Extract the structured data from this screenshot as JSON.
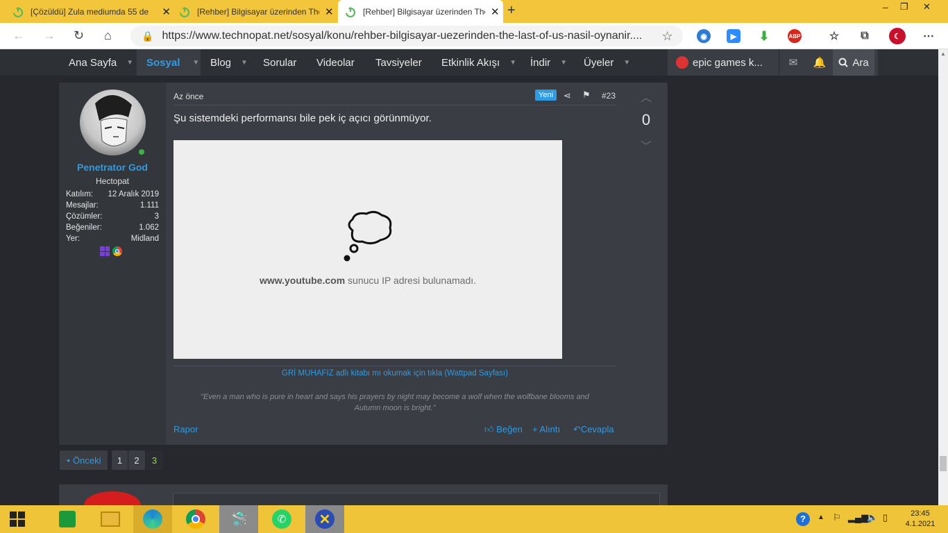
{
  "browser": {
    "tabs": [
      {
        "title": "[Çözüldü] Zula mediumda 55 de"
      },
      {
        "title": "[Rehber] Bilgisayar üzerinden The"
      },
      {
        "title": "[Rehber] Bilgisayar üzerinden The"
      }
    ],
    "new_tab": "+",
    "url": "https://www.technopat.net/sosyal/konu/rehber-bilgisayar-uezerinden-the-last-of-us-nasil-oynanir....",
    "extensions": {
      "abp": "ABP"
    }
  },
  "nav": {
    "items": [
      "Ana Sayfa",
      "Sosyal",
      "Blog",
      "Sorular",
      "Videolar",
      "Tavsiyeler",
      "Etkinlik Akışı",
      "İndir",
      "Üyeler"
    ],
    "search_query": "epic games k...",
    "search_label": "Ara"
  },
  "post": {
    "user": {
      "name": "Penetrator God",
      "title": "Hectopat",
      "stats": [
        {
          "label": "Katılım:",
          "value": "12 Aralık 2019"
        },
        {
          "label": "Mesajlar:",
          "value": "1.111"
        },
        {
          "label": "Çözümler:",
          "value": "3"
        },
        {
          "label": "Beğeniler:",
          "value": "1.062"
        },
        {
          "label": "Yer:",
          "value": "Midland"
        }
      ]
    },
    "time": "Az önce",
    "badge": "Yeni",
    "number": "#23",
    "message": "Şu sistemdeki performansı bile pek iç açıcı görünmüyor.",
    "embed_error_host": "www.youtube.com",
    "embed_error_text": " sunucu IP adresi bulunamadı.",
    "signature_link": "GRİ MUHAFIZ adlı kitabı mı okumak için tıkla (Wattpad Sayfası)",
    "signature_quote": "\"Even a man who is pure in heart and says his prayers by night may become a wolf when the wolfbane blooms and Autumn moon is bright.\"",
    "report": "Rapor",
    "like": "Beğen",
    "quote": "+ Alıntı",
    "reply": "Cevapla",
    "vote_count": "0"
  },
  "pagination": {
    "prev": "Önceki",
    "pages": [
      "1",
      "2",
      "3"
    ],
    "current": "3"
  },
  "taskbar": {
    "time": "23:45",
    "date": "4.1.2021"
  }
}
